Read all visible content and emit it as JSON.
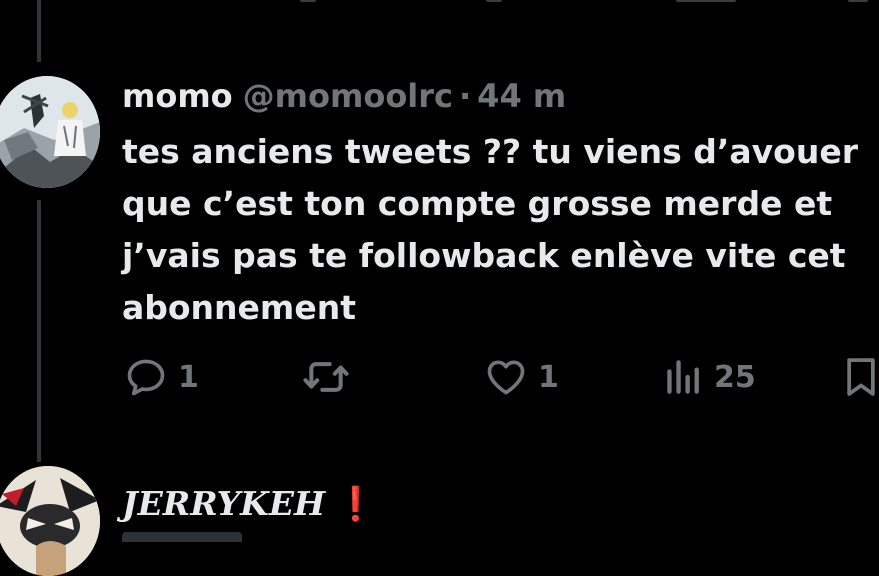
{
  "tweet": {
    "display_name": "momo",
    "handle": "@momoolrc",
    "separator": "·",
    "time": "44 m",
    "text": "tes anciens tweets ?? tu viens d’avouer\nque c’est ton compte grosse merde et\nj’vais pas te followback enlève vite cet\nabonnement",
    "actions": {
      "reply_count": "1",
      "retweet_count": "",
      "like_count": "1",
      "views_count": "25"
    },
    "icons": {
      "reply": "reply-bubble-icon",
      "retweet": "retweet-arrows-icon",
      "like": "heart-icon",
      "views": "views-bars-icon",
      "bookmark": "bookmark-icon"
    }
  },
  "next_tweet": {
    "display_name": "JERRYKEH",
    "badge": "❗"
  },
  "colors": {
    "background": "#000000",
    "text_primary": "#e7e9ea",
    "text_secondary": "#71767b",
    "thread_line": "#333639",
    "badge_red": "#e0232b"
  }
}
